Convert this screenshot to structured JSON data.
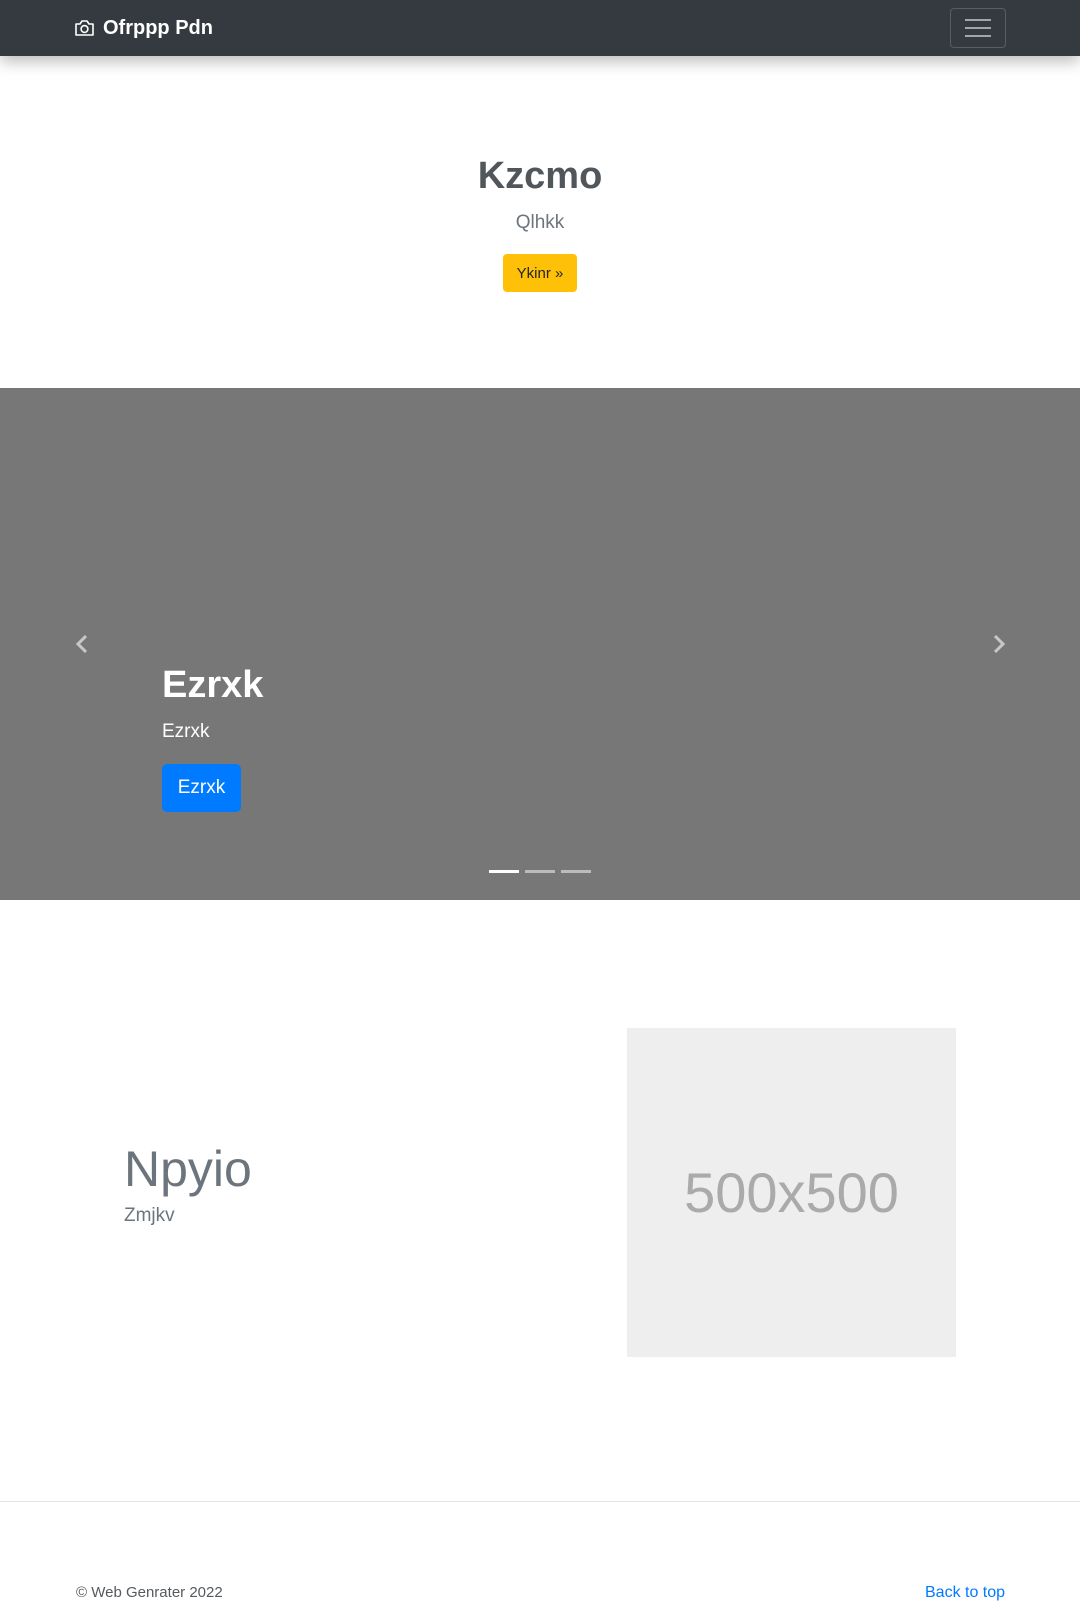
{
  "navbar": {
    "brand": "Ofrppp Pdn",
    "brand_icon": "camera-icon",
    "toggler_icon": "hamburger-menu-icon",
    "background": "#343a40"
  },
  "hero": {
    "title": "Kzcmo",
    "subtitle": "Qlhkk",
    "button_label": "Ykinr »",
    "button_color": "#ffc107"
  },
  "carousel": {
    "background": "#777777",
    "slide": {
      "title": "Ezrxk",
      "text": "Ezrxk",
      "button_label": "Ezrxk",
      "button_color": "#007bff"
    },
    "indicator_count": 3,
    "active_indicator": 0,
    "prev_icon": "chevron-left-icon",
    "next_icon": "chevron-right-icon"
  },
  "featurette": {
    "heading": "Npyio",
    "lead": "Zmjkv",
    "placeholder_text": "500x500"
  },
  "footer": {
    "copyright": "© Web Genrater 2022",
    "back_to_top": "Back to top",
    "link_color": "#007bff"
  }
}
